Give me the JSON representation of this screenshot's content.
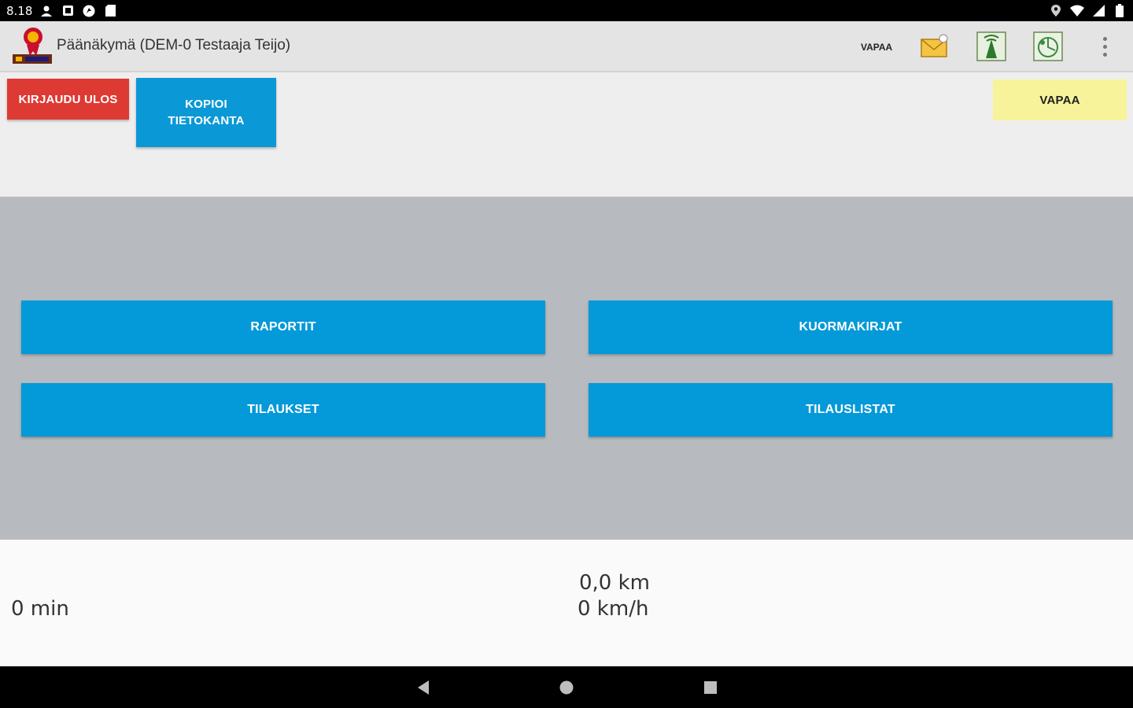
{
  "status_bar": {
    "time": "8.18",
    "left_icons": [
      "person-icon",
      "notification-icon",
      "app-icon",
      "sd-card-icon"
    ],
    "right_icons": [
      "location-icon",
      "wifi-icon",
      "signal-icon",
      "battery-icon"
    ]
  },
  "app_bar": {
    "title": "Päänäkymä (DEM-0 Testaaja Teijo)",
    "status_label": "VAPAA",
    "icons": [
      "mail-icon",
      "antenna-icon",
      "gps-icon",
      "overflow-menu-icon"
    ]
  },
  "top_actions": {
    "logout_label": "KIRJAUDU ULOS",
    "copy_db_label": "KOPIOI TIETOKANTA",
    "status_button_label": "VAPAA"
  },
  "main_buttons": {
    "raportit": "RAPORTIT",
    "kuormakirjat": "KUORMAKIRJAT",
    "tilaukset": "TILAUKSET",
    "tilauslistat": "TILAUSLISTAT"
  },
  "info": {
    "duration": "0 min",
    "distance": "0,0 km",
    "speed": "0 km/h"
  },
  "colors": {
    "logout": "#dd3a33",
    "primary": "#0499d8",
    "status_free": "#f7f39a",
    "main_bg": "#b7babf"
  }
}
